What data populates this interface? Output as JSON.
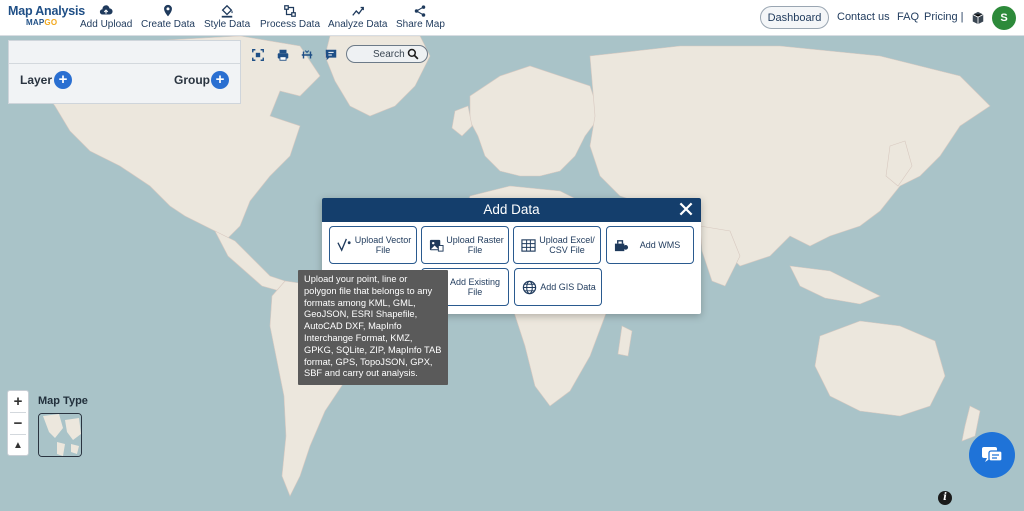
{
  "brand": {
    "title": "Map Analysis",
    "sub_main": "MAP",
    "sub_accent": "GO"
  },
  "nav": [
    {
      "label": "Add Upload",
      "icon": "cloud-upload-icon"
    },
    {
      "label": "Create Data",
      "icon": "location-pin-icon"
    },
    {
      "label": "Style Data",
      "icon": "paint-bucket-icon"
    },
    {
      "label": "Process Data",
      "icon": "process-nodes-icon"
    },
    {
      "label": "Analyze Data",
      "icon": "analyze-chart-icon"
    },
    {
      "label": "Share Map",
      "icon": "share-icon"
    }
  ],
  "top_right": {
    "dashboard": "Dashboard",
    "contact": "Contact us",
    "faq": "FAQ",
    "pricing": "Pricing |",
    "avatar_initial": "S"
  },
  "layer_panel": {
    "layer_label": "Layer",
    "group_label": "Group"
  },
  "search": {
    "placeholder": "Search"
  },
  "map_controls": {
    "zoom_in": "+",
    "zoom_out": "−",
    "compass": "▲",
    "map_type_label": "Map Type"
  },
  "modal": {
    "title": "Add Data",
    "options": [
      {
        "label": "Upload Vector File",
        "icon": "vector-icon"
      },
      {
        "label": "Upload Raster File",
        "icon": "raster-image-icon"
      },
      {
        "label": "Upload Excel/ CSV File",
        "icon": "spreadsheet-icon"
      },
      {
        "label": "Add WMS",
        "icon": "wms-icon"
      },
      {
        "label": "Add Existing File",
        "icon": "existing-file-icon"
      },
      {
        "label": "Add GIS Data",
        "icon": "globe-icon"
      }
    ]
  },
  "tooltip": {
    "text": "Upload your point, line or polygon file that belongs to any formats among KML, GML, GeoJSON, ESRI Shapefile, AutoCAD DXF, MapInfo Interchange Format, KMZ, GPKG, SQLite, ZIP, MapInfo TAB format, GPS, TopoJSON, GPX, SBF and carry out analysis."
  },
  "colors": {
    "ocean": "#a9c3c8",
    "land": "#ece7dd",
    "modal_header": "#143e6c",
    "accent_blue": "#2a6fd1",
    "avatar_green": "#2d8a3a",
    "chat_blue": "#1f73d8"
  }
}
